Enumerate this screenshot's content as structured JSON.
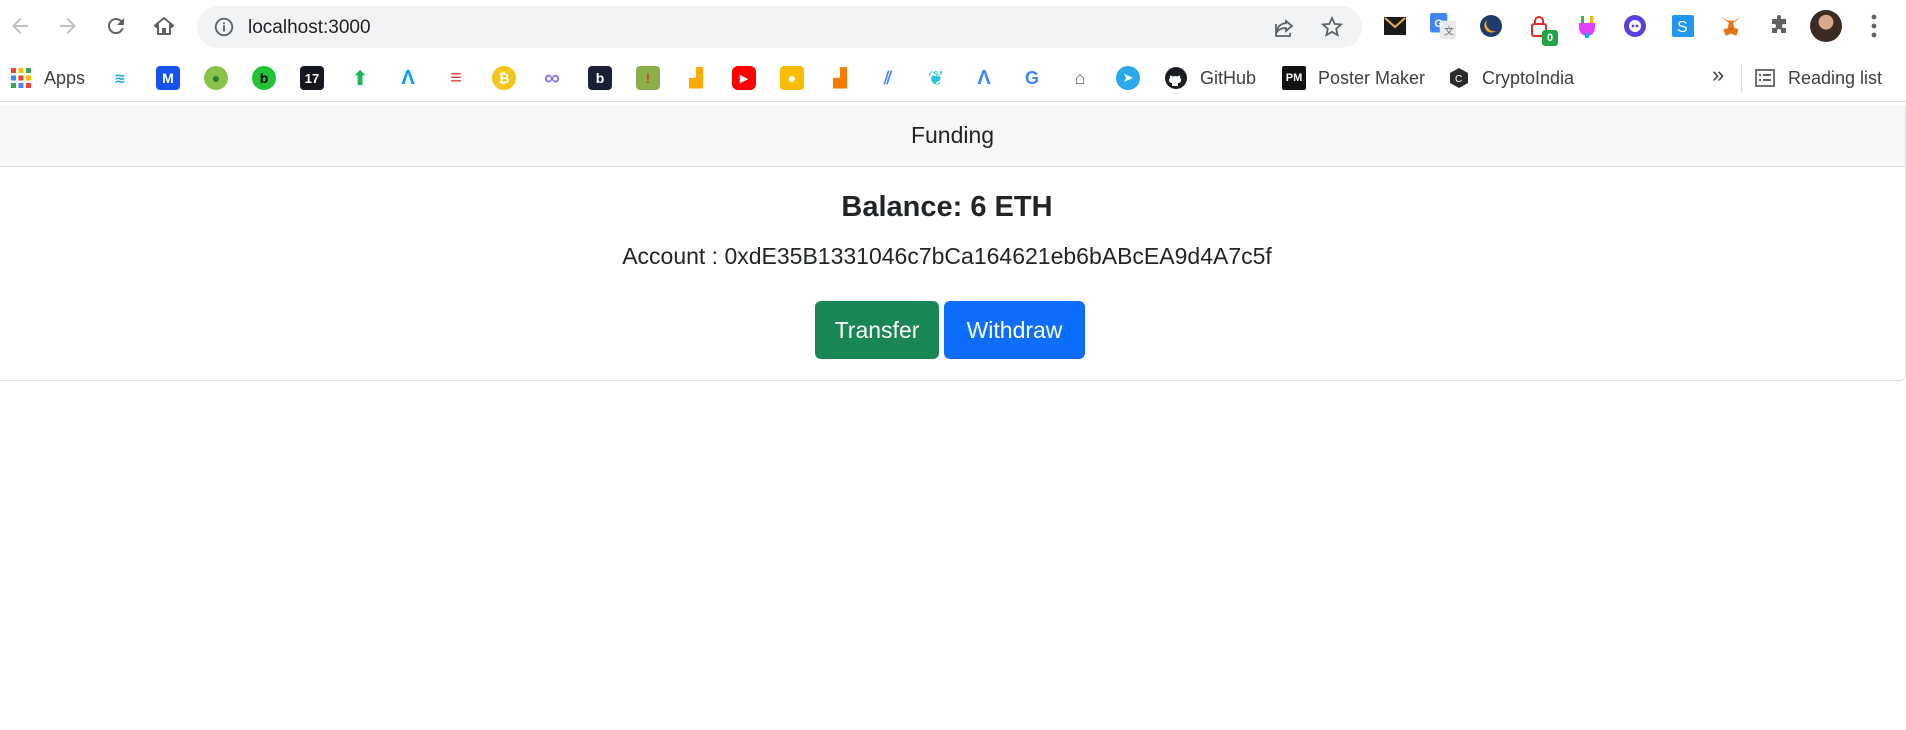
{
  "browser": {
    "url": "localhost:3000",
    "extensions": [
      {
        "icon": "mail-mask-extension-icon"
      },
      {
        "icon": "google-translate-extension-icon"
      },
      {
        "icon": "dark-moon-extension-icon"
      },
      {
        "icon": "lock-extension-icon",
        "badge": "0"
      },
      {
        "icon": "plug-extension-icon"
      },
      {
        "icon": "bot-extension-icon"
      },
      {
        "icon": "s-extension-icon"
      },
      {
        "icon": "metamask-fox-icon"
      },
      {
        "icon": "puzzle-icon"
      }
    ],
    "bookmarks": {
      "apps_label": "Apps",
      "github_label": "GitHub",
      "poster_maker_label": "Poster Maker",
      "cryptoindia_label": "CryptoIndia",
      "more_label": "»",
      "reading_list_label": "Reading list"
    }
  },
  "card": {
    "header": "Funding",
    "balance": "Balance: 6 ETH",
    "account": "Account : 0xdE35B1331046c7bCa164621eb6bABcEA9d4A7c5f"
  },
  "actions": {
    "transfer_label": "Transfer",
    "withdraw_label": "Withdraw"
  },
  "colors": {
    "transfer": "#198754",
    "withdraw": "#0d6efd",
    "header_bg": "#f7f7f7"
  }
}
